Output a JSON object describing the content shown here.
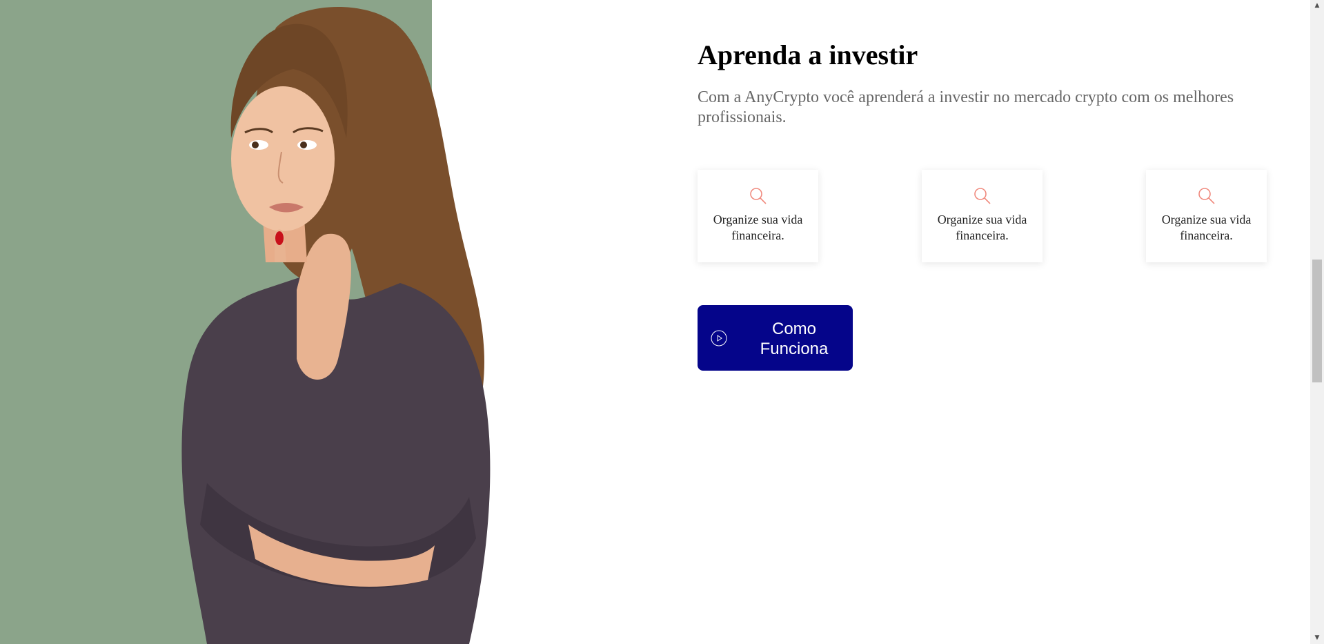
{
  "hero": {
    "image_description": "woman-thinking-photo"
  },
  "section": {
    "title": "Aprenda a investir",
    "subtitle": "Com a AnyCrypto você aprenderá a investir no mercado crypto com os melhores profissionais."
  },
  "features": [
    {
      "icon": "search-icon",
      "text": "Organize sua vida financeira."
    },
    {
      "icon": "search-icon",
      "text": "Organize sua vida financeira."
    },
    {
      "icon": "search-icon",
      "text": "Organize sua vida financeira."
    }
  ],
  "cta": {
    "label": "Como Funciona",
    "icon": "play-circle-icon"
  },
  "colors": {
    "hero_bg": "#8ba48a",
    "cta_bg": "#05058a",
    "icon_accent": "#f08a7e"
  }
}
